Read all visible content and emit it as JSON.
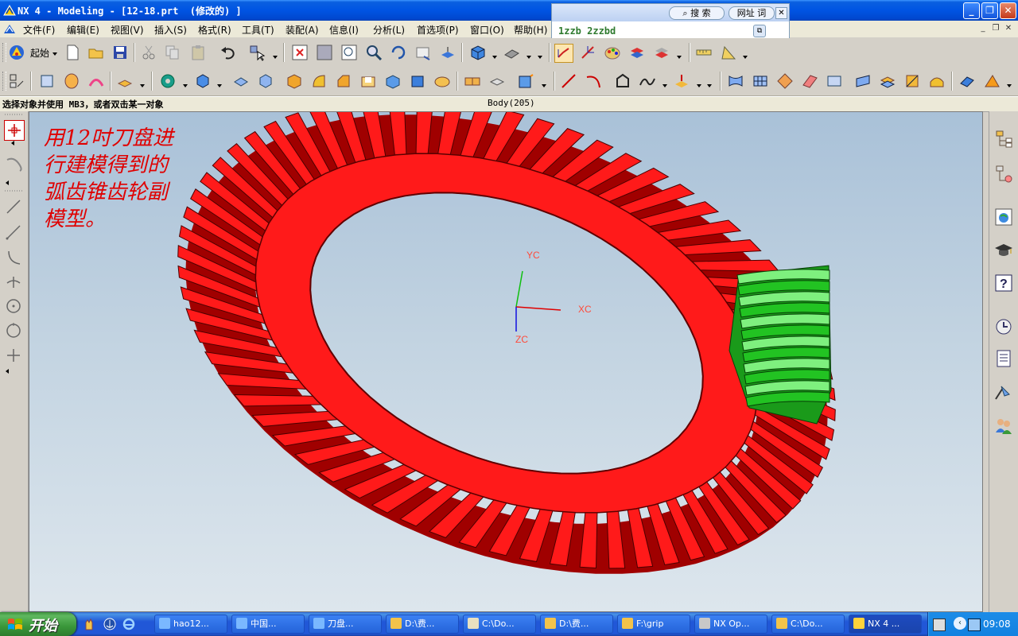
{
  "window": {
    "title": "NX 4 - Modeling - [12-18.prt  (修改的) ]",
    "minimize_glyph": "_",
    "maximize_glyph": "❐",
    "close_glyph": "✕"
  },
  "search_popup": {
    "search_label": "搜 索",
    "link_label": "网址 词",
    "close_glyph": "✕",
    "input_value": "1zzb 2zzbd"
  },
  "menu": {
    "items": [
      "文件(F)",
      "编辑(E)",
      "视图(V)",
      "插入(S)",
      "格式(R)",
      "工具(T)",
      "装配(A)",
      "信息(I)",
      "分析(L)",
      "首选项(P)",
      "窗口(O)",
      "帮助(H)"
    ],
    "mdi_min": "_",
    "mdi_restore": "❐",
    "mdi_close": "✕"
  },
  "toolbar": {
    "start_label": "起始"
  },
  "status": {
    "cue": "选择对象并使用 MB3，或者双击某一对象",
    "selection": "Body(205)"
  },
  "graphics": {
    "annotation_lines": [
      "用12吋刀盘进",
      "行建模得到的",
      "弧齿锥齿轮副",
      "模型。"
    ],
    "axis_labels": {
      "x": "XC",
      "y": "YC",
      "z": "ZC"
    },
    "colors": {
      "ring_gear": "#ff1a1a",
      "pinion": "#22c322",
      "background_top": "#a9c1d8",
      "background_bottom": "#dde6ed"
    },
    "ring_teeth_count": 68
  },
  "taskbar": {
    "start": "开始",
    "tasks": [
      "hao12...",
      "中国...",
      "刀盘...",
      "D:\\费...",
      "C:\\Do...",
      "D:\\费...",
      "F:\\grip",
      "NX Op...",
      "C:\\Do...",
      "NX 4 ..."
    ],
    "active_task_index": 9,
    "clock": "09:08"
  }
}
